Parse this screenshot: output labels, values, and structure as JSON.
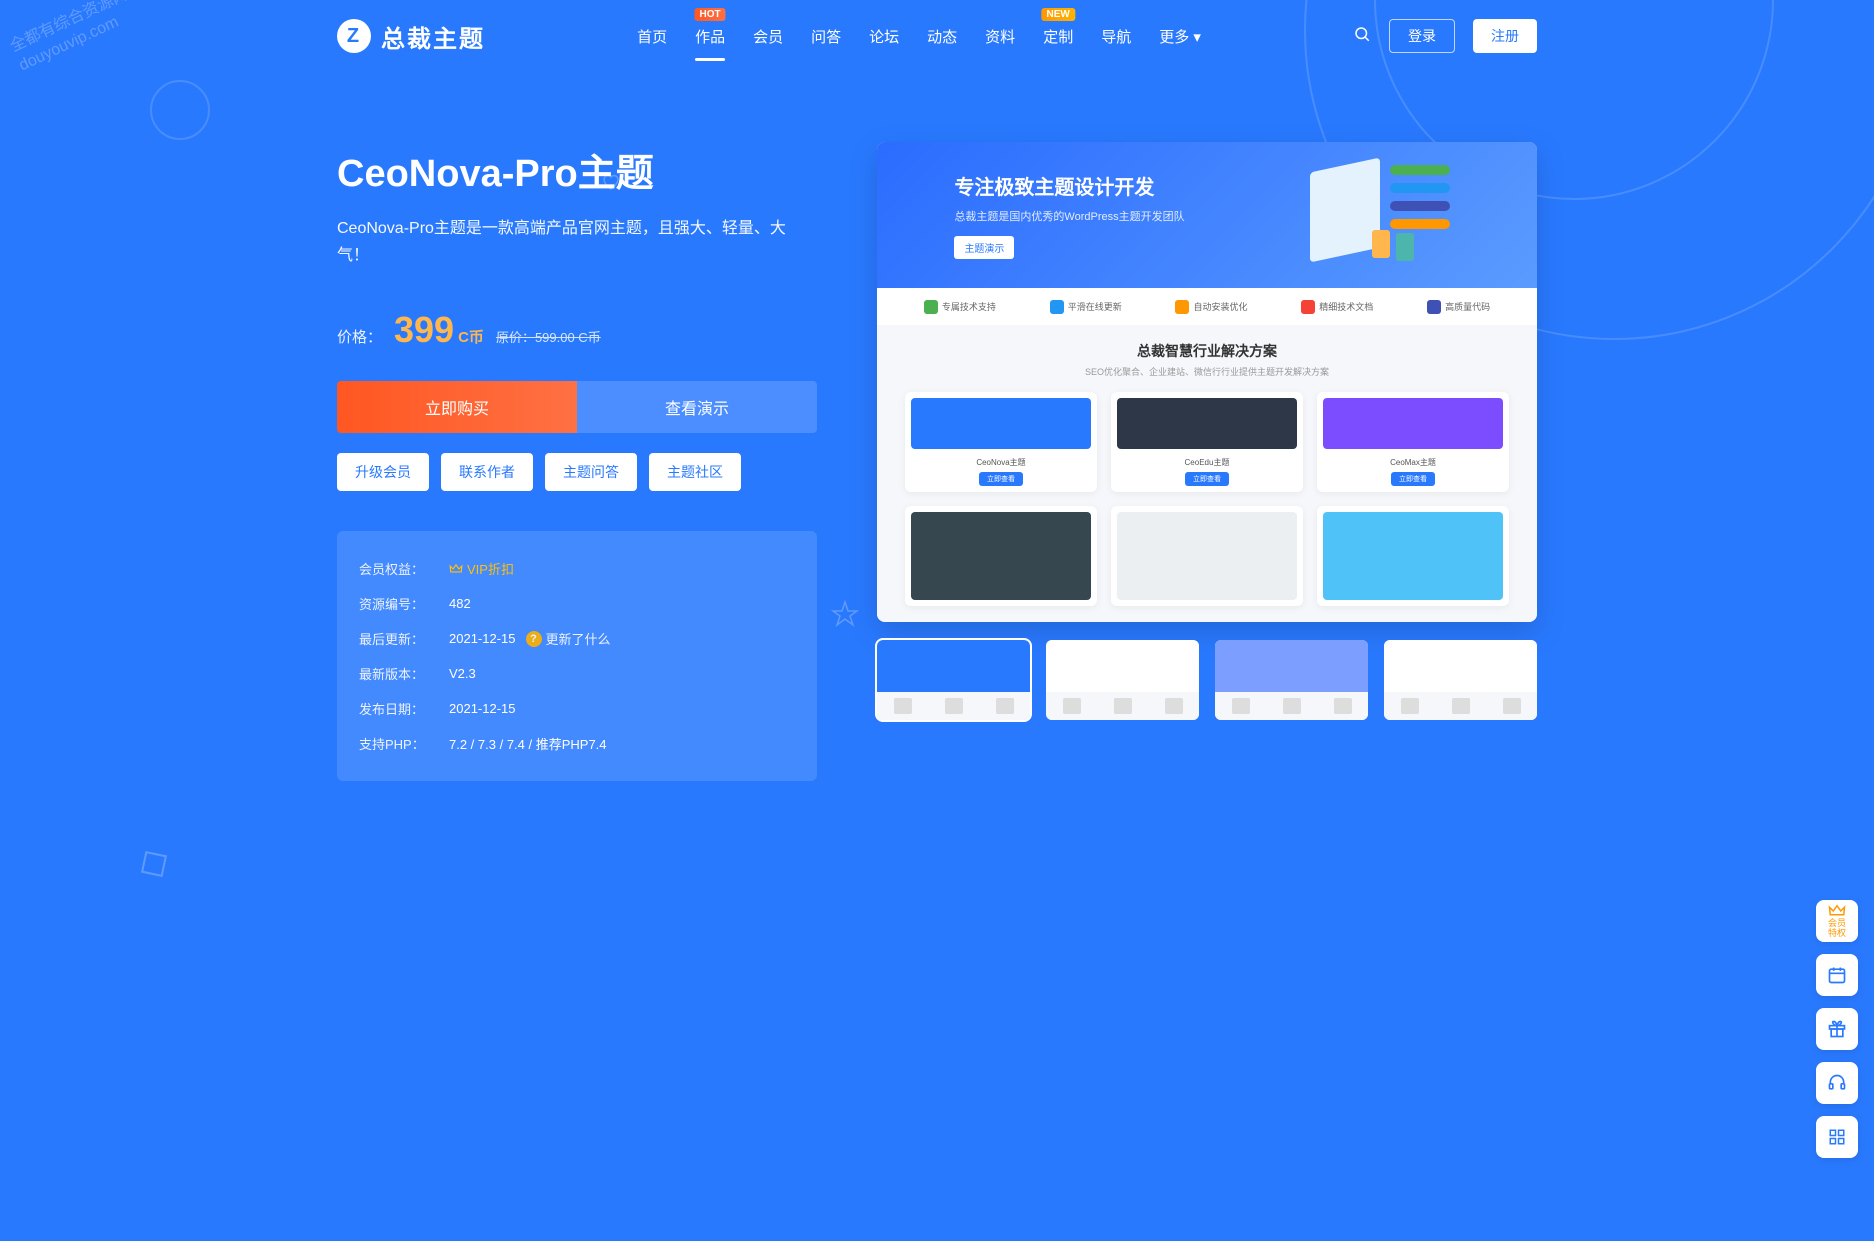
{
  "watermark": {
    "line1": "全都有综合资源网",
    "line2": "douyouvip.com"
  },
  "header": {
    "logo_text": "总裁主题",
    "nav": [
      {
        "label": "首页",
        "badge": null,
        "active": false
      },
      {
        "label": "作品",
        "badge": "HOT",
        "badge_type": "hot",
        "active": true
      },
      {
        "label": "会员",
        "badge": null,
        "active": false
      },
      {
        "label": "问答",
        "badge": null,
        "active": false
      },
      {
        "label": "论坛",
        "badge": null,
        "active": false
      },
      {
        "label": "动态",
        "badge": null,
        "active": false
      },
      {
        "label": "资料",
        "badge": null,
        "active": false
      },
      {
        "label": "定制",
        "badge": "NEW",
        "badge_type": "new",
        "active": false
      },
      {
        "label": "导航",
        "badge": null,
        "active": false
      },
      {
        "label": "更多 ▾",
        "badge": null,
        "active": false
      }
    ],
    "login_label": "登录",
    "register_label": "注册"
  },
  "product": {
    "title": "CeoNova-Pro主题",
    "description": "CeoNova-Pro主题是一款高端产品官网主题，且强大、轻量、大气！",
    "price_label": "价格：",
    "price_value": "399",
    "price_unit": "C币",
    "price_old": "原价：599.00 C币",
    "buy_label": "立即购买",
    "demo_label": "查看演示",
    "actions": [
      {
        "label": "升级会员"
      },
      {
        "label": "联系作者"
      },
      {
        "label": "主题问答"
      },
      {
        "label": "主题社区"
      }
    ],
    "info": {
      "rows": [
        {
          "label": "会员权益：",
          "value": "VIP折扣",
          "type": "vip"
        },
        {
          "label": "资源编号：",
          "value": "482",
          "type": "text"
        },
        {
          "label": "最后更新：",
          "value": "2021-12-15",
          "type": "update",
          "extra": "更新了什么"
        },
        {
          "label": "最新版本：",
          "value": "V2.3",
          "type": "text"
        },
        {
          "label": "发布日期：",
          "value": "2021-12-15",
          "type": "text"
        },
        {
          "label": "支持PHP：",
          "value": "7.2 / 7.3 / 7.4 / 推荐PHP7.4",
          "type": "text"
        }
      ]
    }
  },
  "preview": {
    "hero_title": "专注极致主题设计开发",
    "hero_sub": "总裁主题是国内优秀的WordPress主题开发团队",
    "hero_btn": "主题演示",
    "features": [
      "专属技术支持",
      "平滑在线更新",
      "自动安装优化",
      "精细技术文档",
      "高质量代码"
    ],
    "body_title": "总裁智慧行业解决方案",
    "body_sub": "SEO优化聚合、企业建站、微信行行业提供主题开发解决方案",
    "cards": [
      {
        "label": "CeoNova主题",
        "btn": "立即查看",
        "color": "#2979ff"
      },
      {
        "label": "CeoEdu主题",
        "btn": "立即查看",
        "color": "#2d3748"
      },
      {
        "label": "CeoMax主题",
        "btn": "立即查看",
        "color": "#7c4dff"
      },
      {
        "label": "",
        "btn": "",
        "color": "#37474f"
      },
      {
        "label": "",
        "btn": "",
        "color": "#eceff1"
      },
      {
        "label": "",
        "btn": "",
        "color": "#4fc3f7"
      }
    ]
  },
  "thumbnails": [
    {
      "top_color": "#2979ff",
      "active": true
    },
    {
      "top_color": "#ffffff",
      "active": false
    },
    {
      "top_color": "#7c9fff",
      "active": false
    },
    {
      "top_color": "#ffffff",
      "active": false
    }
  ],
  "float_bar": {
    "vip_label": "会员\n特权",
    "items": [
      "calendar",
      "gift",
      "headset",
      "grid"
    ]
  }
}
